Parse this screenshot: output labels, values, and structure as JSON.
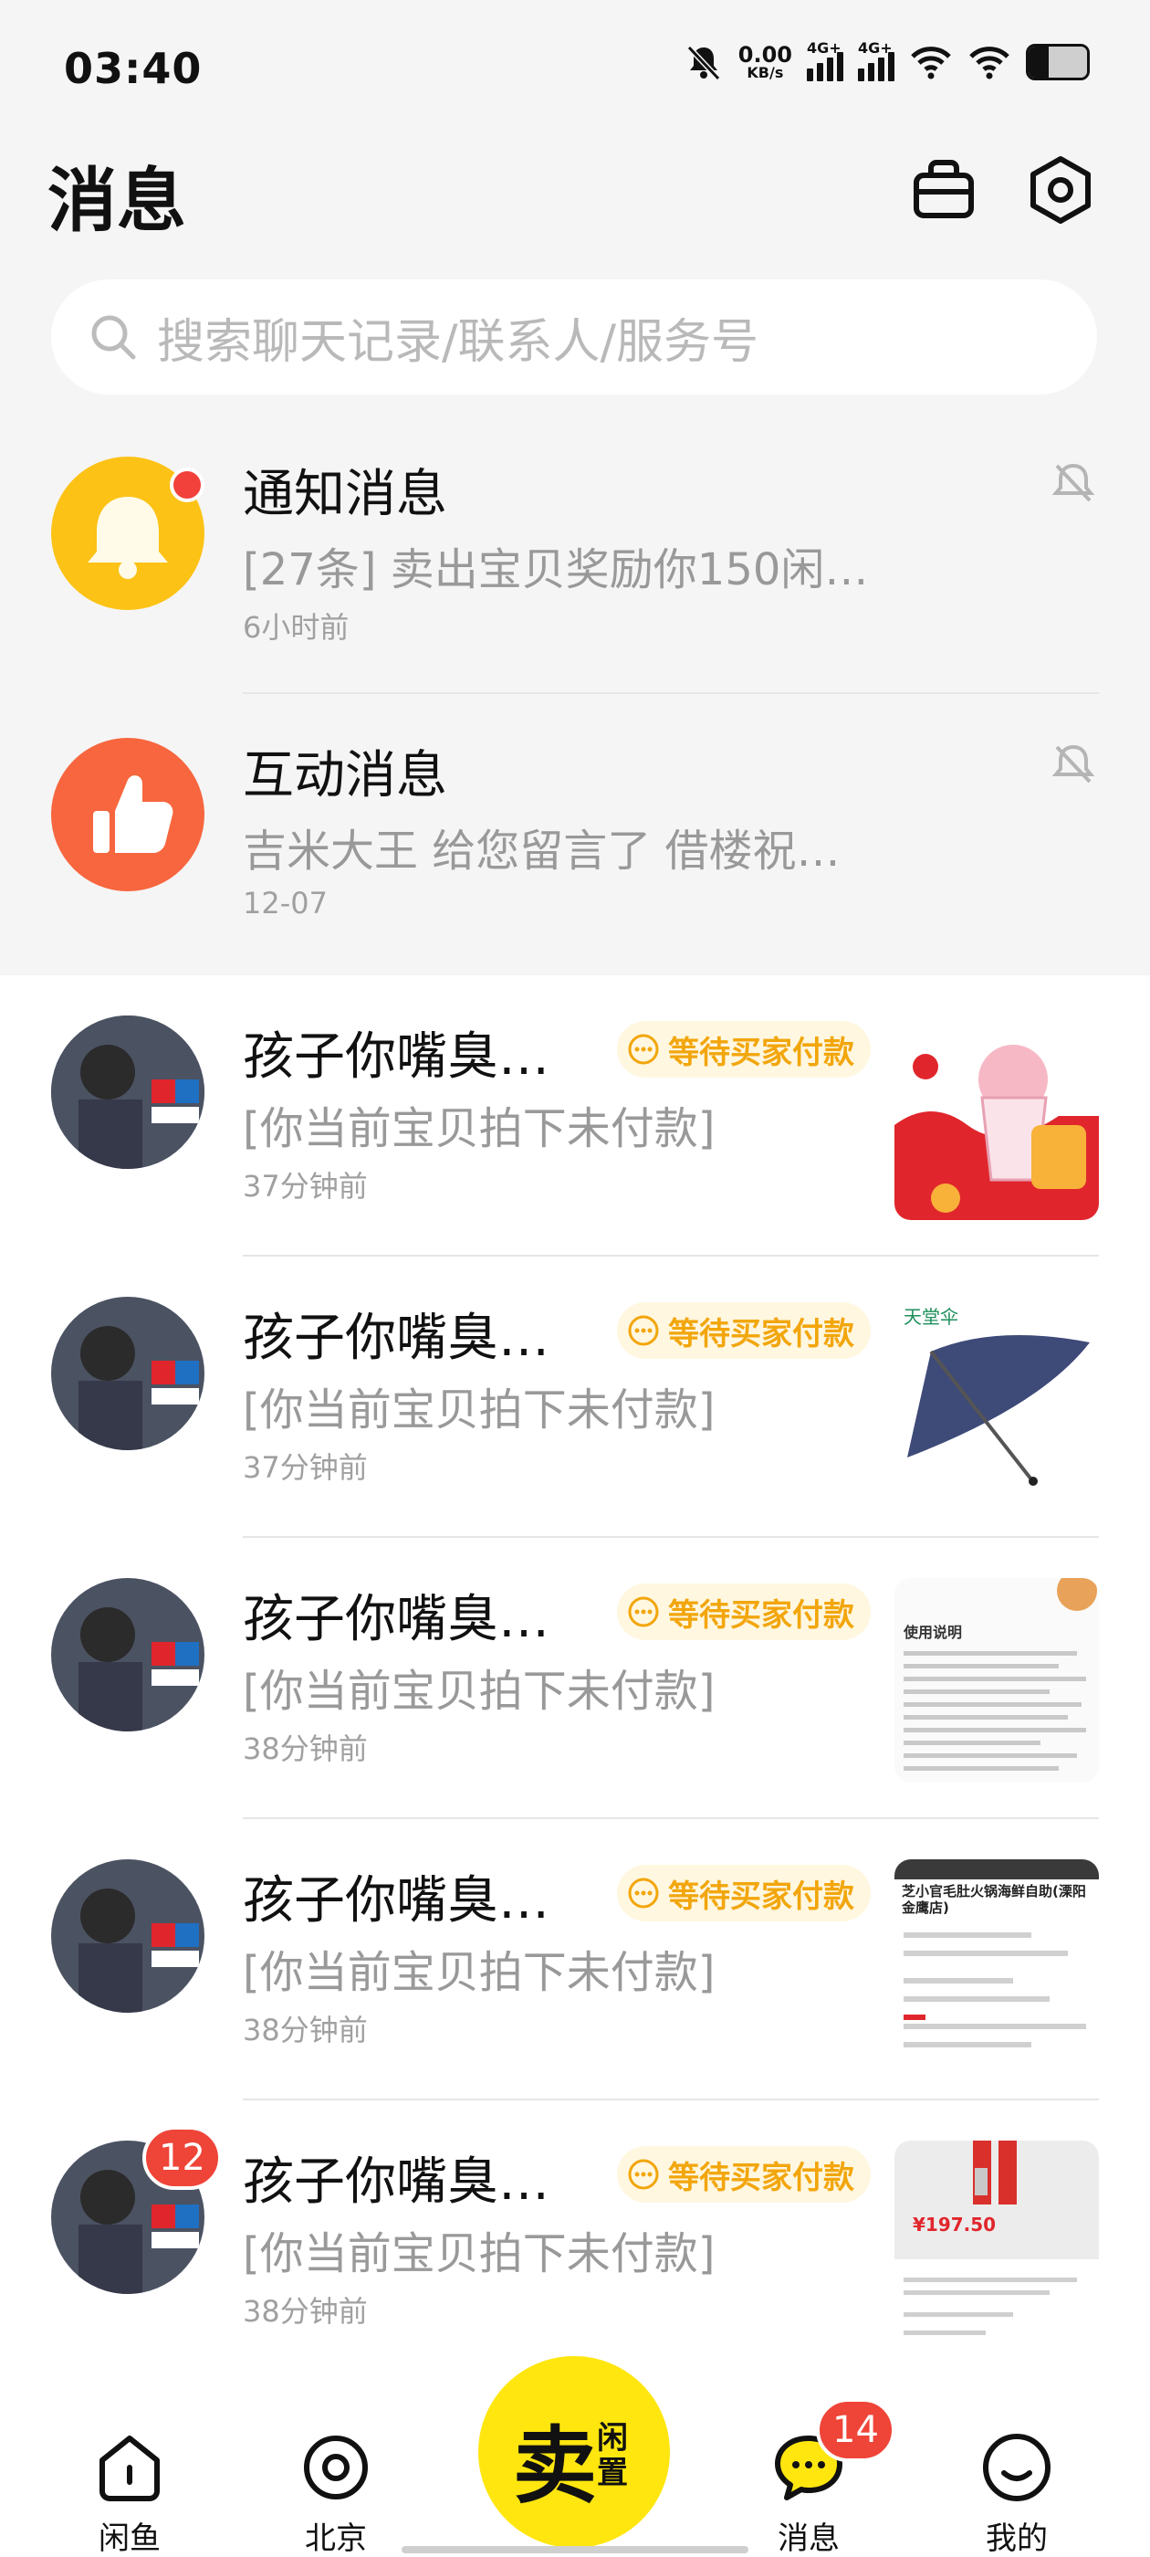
{
  "status_bar": {
    "time": "03:40",
    "net_speed_value": "0.00",
    "net_speed_unit": "KB/s",
    "signal_1": "4G+",
    "signal_2": "4G+",
    "battery_level": 0.35
  },
  "header": {
    "title": "消息",
    "icons": [
      "bag-icon",
      "settings-icon"
    ]
  },
  "search": {
    "placeholder": "搜索聊天记录/联系人/服务号"
  },
  "system_rows": [
    {
      "title": "通知消息",
      "preview": "[27条] 卖出宝贝奖励你150闲…",
      "time": "6小时前",
      "icon": "bell-icon",
      "color": "#fcc215",
      "unread_dot": true
    },
    {
      "title": "互动消息",
      "preview": "吉米大王 给您留言了 借楼祝…",
      "time": "12-07",
      "icon": "thumbs-up-icon",
      "color": "#f7663e",
      "unread_dot": false
    }
  ],
  "chat_rows": [
    {
      "name": "孩子你嘴臭…",
      "status": "等待买家付款",
      "preview": "[你当前宝贝拍下未付款]",
      "time": "37分钟前",
      "thumb": "ice-cream-drink-image"
    },
    {
      "name": "孩子你嘴臭…",
      "status": "等待买家付款",
      "preview": "[你当前宝贝拍下未付款]",
      "time": "37分钟前",
      "thumb": "umbrella-image",
      "thumb_text": "天堂伞"
    },
    {
      "name": "孩子你嘴臭…",
      "status": "等待买家付款",
      "preview": "[你当前宝贝拍下未付款]",
      "time": "38分钟前",
      "thumb": "coupon-instructions-image",
      "thumb_text": "使用说明"
    },
    {
      "name": "孩子你嘴臭…",
      "status": "等待买家付款",
      "preview": "[你当前宝贝拍下未付款]",
      "time": "38分钟前",
      "thumb": "hotpot-voucher-image",
      "thumb_text": "芝小官毛肚火锅海鲜自助(溧阳金鹰店)"
    },
    {
      "name": "孩子你嘴臭…",
      "status": "等待买家付款",
      "preview": "[你当前宝贝拍下未付款]",
      "time": "38分钟前",
      "thumb": "ultraman-figure-image",
      "thumb_text": "¥197.50",
      "badge": "12"
    }
  ],
  "tabbar": {
    "items": [
      {
        "label": "闲鱼",
        "icon": "home-icon"
      },
      {
        "label": "北京",
        "icon": "location-icon"
      },
      {
        "label": "消息",
        "icon": "chat-icon",
        "badge": "14"
      },
      {
        "label": "我的",
        "icon": "smile-icon"
      }
    ],
    "sell": {
      "big": "卖",
      "small_1": "闲",
      "small_2": "置"
    }
  },
  "colors": {
    "accent_yellow": "#ffe60f",
    "status_orange": "#f2a60c",
    "badge_red": "#ef4438"
  }
}
